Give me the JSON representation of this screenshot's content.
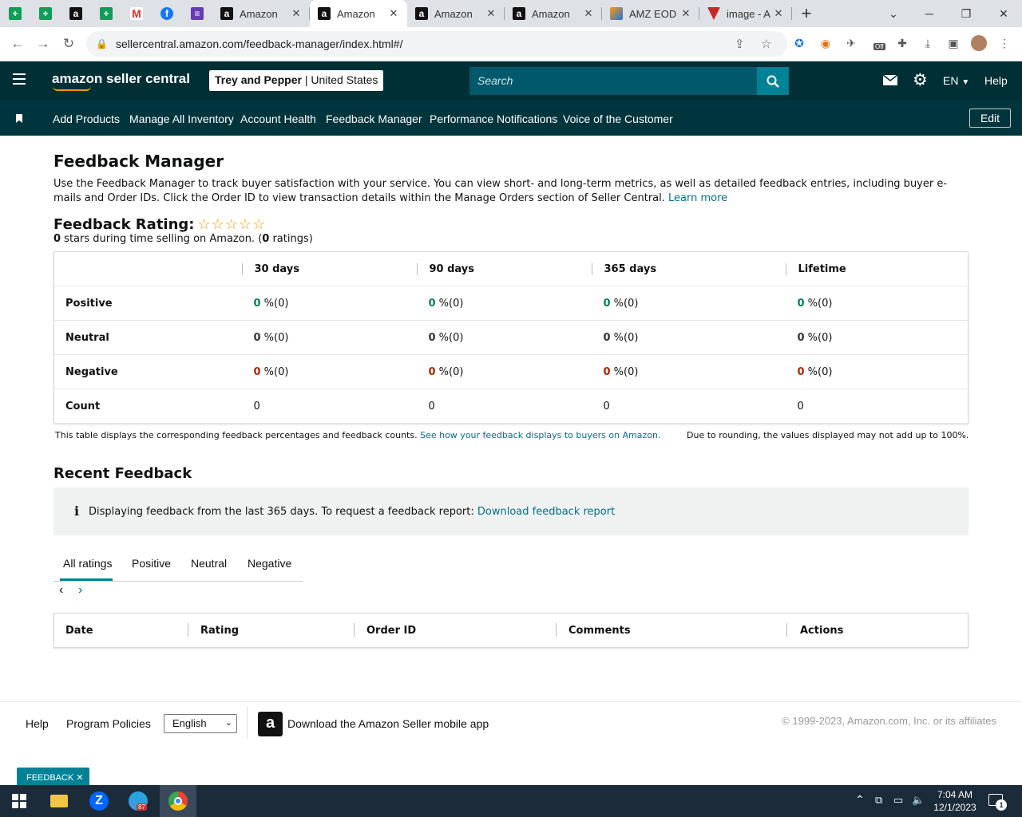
{
  "browser": {
    "tabs": [
      {
        "title": "Amazon",
        "icon": "amazon-favicon"
      },
      {
        "title": "Amazon",
        "icon": "amazon-favicon",
        "active": true
      },
      {
        "title": "Amazon",
        "icon": "amazon-favicon"
      },
      {
        "title": "Amazon",
        "icon": "amazon-favicon"
      },
      {
        "title": "AMZ EOD",
        "icon": "amz-eod-favicon"
      },
      {
        "title": "image - A",
        "icon": "image-favicon"
      }
    ],
    "url": "sellercentral.amazon.com/feedback-manager/index.html#/",
    "ext_badge": "Off"
  },
  "header": {
    "logo": "amazon seller central",
    "store_name": "Trey and Pepper",
    "store_region": "United States",
    "search_placeholder": "Search",
    "language": "EN",
    "help": "Help"
  },
  "nav": {
    "items": [
      "Add Products",
      "Manage All Inventory",
      "Account Health",
      "Feedback Manager",
      "Performance Notifications",
      "Voice of the Customer"
    ],
    "edit": "Edit"
  },
  "page": {
    "title": "Feedback Manager",
    "intro": "Use the Feedback Manager to track buyer satisfaction with your service. You can view short- and long-term metrics, as well as detailed feedback entries, including buyer e-mails and Order IDs. Click the Order ID to view transaction details within the Manage Orders section of Seller Central.",
    "learn_more": "Learn more",
    "rating_label": "Feedback Rating:",
    "rating_stars": 0,
    "rating_summary_stars": "0",
    "rating_summary_text1": " stars during time selling on Amazon. (",
    "rating_summary_count": "0",
    "rating_summary_text2": " ratings)"
  },
  "metrics": {
    "columns": [
      "30 days",
      "90 days",
      "365 days",
      "Lifetime"
    ],
    "rows": [
      {
        "label": "Positive",
        "values": [
          "0",
          "0",
          "0",
          "0"
        ],
        "suffix": " %(0)"
      },
      {
        "label": "Neutral",
        "values": [
          "0",
          "0",
          "0",
          "0"
        ],
        "suffix": " %(0)"
      },
      {
        "label": "Negative",
        "values": [
          "0",
          "0",
          "0",
          "0"
        ],
        "suffix": " %(0)"
      },
      {
        "label": "Count",
        "values": [
          "0",
          "0",
          "0",
          "0"
        ],
        "suffix": ""
      }
    ],
    "note": "This table displays the corresponding feedback percentages and feedback counts.",
    "note_link": "See how your feedback displays to buyers on Amazon.",
    "rounding_note": "Due to rounding, the values displayed may not add up to 100%."
  },
  "recent": {
    "title": "Recent Feedback",
    "info_text": "Displaying feedback from the last 365 days. To request a feedback report:",
    "info_link": "Download feedback report",
    "tabs": [
      "All ratings",
      "Positive",
      "Neutral",
      "Negative"
    ],
    "columns": [
      "Date",
      "Rating",
      "Order ID",
      "Comments",
      "Actions"
    ]
  },
  "footer": {
    "help": "Help",
    "policies": "Program Policies",
    "language": "English",
    "app": "Download the Amazon Seller mobile app",
    "copyright": "© 1999-2023, Amazon.com, Inc. or its affiliates",
    "feedback_tab": "FEEDBACK"
  },
  "taskbar": {
    "time": "7:04 AM",
    "date": "12/1/2023",
    "telegram_badge": "87",
    "notif_count": "1"
  },
  "colors": {
    "header_bg": "#002f36",
    "nav_bg": "#00353d",
    "search_btn": "#008296",
    "link": "#007185",
    "positive": "#067d62",
    "negative": "#b12704"
  }
}
